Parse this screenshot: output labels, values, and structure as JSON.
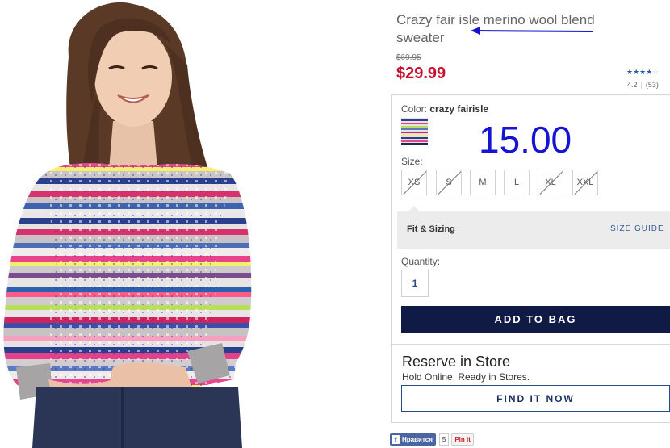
{
  "product": {
    "title": "Crazy fair isle merino wool blend sweater",
    "original_price": "$69.95",
    "sale_price": "$29.99",
    "rating_value": 4.2,
    "rating_text": "4.2",
    "review_count": "(53)",
    "stars": "★★★★",
    "stars_dim": "☆"
  },
  "color": {
    "label": "Color:",
    "selected": "crazy fairisle"
  },
  "overlay_number": "15.00",
  "sizes": {
    "label": "Size:",
    "options": [
      {
        "label": "XS",
        "available": false
      },
      {
        "label": "S",
        "available": false
      },
      {
        "label": "M",
        "available": true
      },
      {
        "label": "L",
        "available": true
      },
      {
        "label": "XL",
        "available": false
      },
      {
        "label": "XXL",
        "available": false
      }
    ]
  },
  "fit": {
    "title": "Fit & Sizing",
    "size_guide": "SIZE GUIDE"
  },
  "quantity": {
    "label": "Quantity:",
    "value": "1"
  },
  "add_to_bag": "ADD TO BAG",
  "reserve": {
    "title": "Reserve in Store",
    "subtitle": "Hold Online. Ready in Stores.",
    "button": "FIND IT NOW"
  },
  "social": {
    "facebook_label": "Нравится",
    "facebook_icon": "f",
    "facebook_count": "5",
    "pinterest_label": "Pin it"
  },
  "colors": {
    "price_red": "#c8102e",
    "navy": "#0f1a45",
    "annotation_blue": "#1414d2"
  }
}
